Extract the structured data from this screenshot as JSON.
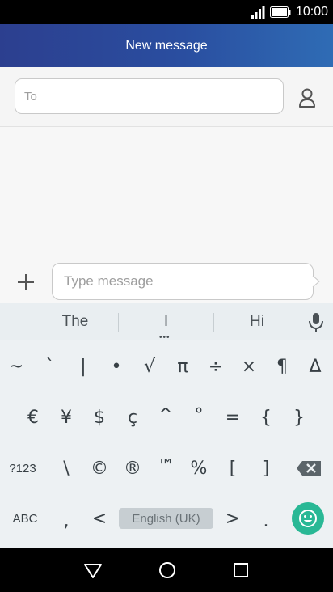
{
  "status": {
    "time": "10:00"
  },
  "app_bar": {
    "title": "New message"
  },
  "compose": {
    "to_placeholder": "To",
    "message_placeholder": "Type message"
  },
  "suggestions": [
    "The",
    "I",
    "Hi"
  ],
  "keyboard": {
    "row1": [
      "~",
      "`",
      "|",
      "•",
      "√",
      "π",
      "÷",
      "×",
      "¶",
      "Δ"
    ],
    "row2": [
      "€",
      "¥",
      "$",
      "ç",
      "^",
      "°",
      "=",
      "{",
      "}"
    ],
    "row3": [
      "?123",
      "\\",
      "©",
      "®",
      "™",
      "%",
      "[",
      "]"
    ],
    "row4": [
      "ABC",
      ",",
      "<",
      ">",
      "."
    ],
    "spacebar_label": "English (UK)"
  },
  "colors": {
    "app_bar_start": "#2c3f8f",
    "app_bar_end": "#2f6cb5",
    "emoji_button": "#29b895"
  },
  "icons": [
    "signal-icon",
    "battery-icon",
    "contact-icon",
    "add-icon",
    "send-icon",
    "mic-icon",
    "backspace-icon",
    "emoji-icon",
    "back-icon",
    "home-icon",
    "recents-icon"
  ]
}
